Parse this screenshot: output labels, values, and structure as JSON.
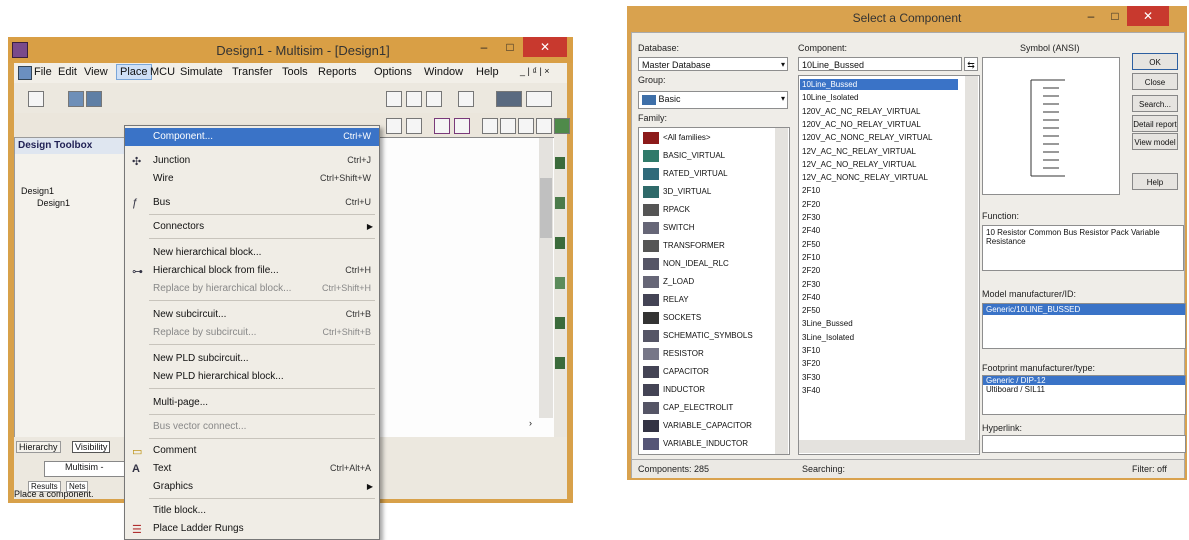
{
  "left_window": {
    "title": "Design1 - Multisim - [Design1]",
    "controls": {
      "minimize": "–",
      "maximize": "□",
      "close": "✕"
    },
    "menu": [
      "File",
      "Edit",
      "View",
      "Place",
      "MCU",
      "Simulate",
      "Transfer",
      "Tools",
      "Reports",
      "Options",
      "Window",
      "Help"
    ],
    "menu_right": "_ | ₫ | ×",
    "design_toolbox": {
      "header": "Design Toolbox",
      "tree": [
        "Design1",
        "Design1"
      ]
    },
    "bottom_tabs": [
      "Hierarchy",
      "Visibility"
    ],
    "bottom_panel_text": "Multisim - ",
    "results_tabs": [
      "Results",
      "Nets"
    ],
    "status_text": "Place a component.",
    "place_menu": [
      {
        "label": "Component...",
        "shortcut": "Ctrl+W",
        "highlight": true
      },
      {
        "label": "Junction",
        "shortcut": "Ctrl+J",
        "icon": "junction-icon"
      },
      {
        "label": "Wire",
        "shortcut": "Ctrl+Shift+W"
      },
      {
        "label": "Bus",
        "shortcut": "Ctrl+U",
        "icon": "bus-icon"
      },
      {
        "label": "Connectors",
        "shortcut": "",
        "submenu": true
      },
      {
        "label": "New hierarchical block...",
        "shortcut": ""
      },
      {
        "label": "Hierarchical block from file...",
        "shortcut": "Ctrl+H",
        "icon": "hier-icon"
      },
      {
        "label": "Replace by hierarchical block...",
        "shortcut": "Ctrl+Shift+H",
        "disabled": true
      },
      {
        "label": "New subcircuit...",
        "shortcut": "Ctrl+B"
      },
      {
        "label": "Replace by subcircuit...",
        "shortcut": "Ctrl+Shift+B",
        "disabled": true
      },
      {
        "label": "New PLD subcircuit...",
        "shortcut": ""
      },
      {
        "label": "New PLD hierarchical block...",
        "shortcut": ""
      },
      {
        "label": "Multi-page...",
        "shortcut": ""
      },
      {
        "label": "Bus vector connect...",
        "shortcut": "",
        "disabled": true
      },
      {
        "label": "Comment",
        "shortcut": "",
        "icon": "comment-icon"
      },
      {
        "label": "Text",
        "shortcut": "Ctrl+Alt+A",
        "icon": "text-icon"
      },
      {
        "label": "Graphics",
        "shortcut": "",
        "submenu": true
      },
      {
        "label": "Title block...",
        "shortcut": ""
      },
      {
        "label": "Place Ladder Rungs",
        "shortcut": "",
        "icon": "ladder-icon"
      }
    ]
  },
  "right_window": {
    "title": "Select a Component",
    "controls": {
      "minimize": "–",
      "maximize": "□",
      "close": "✕"
    },
    "database_label": "Database:",
    "database_value": "Master Database",
    "group_label": "Group:",
    "group_value": "Basic",
    "family_label": "Family:",
    "families": [
      "<All families>",
      "BASIC_VIRTUAL",
      "RATED_VIRTUAL",
      "3D_VIRTUAL",
      "RPACK",
      "SWITCH",
      "TRANSFORMER",
      "NON_IDEAL_RLC",
      "Z_LOAD",
      "RELAY",
      "SOCKETS",
      "SCHEMATIC_SYMBOLS",
      "RESISTOR",
      "CAPACITOR",
      "INDUCTOR",
      "CAP_ELECTROLIT",
      "VARIABLE_CAPACITOR",
      "VARIABLE_INDUCTOR"
    ],
    "component_label": "Component:",
    "component_value": "10Line_Bussed",
    "components": [
      "10Line_Bussed",
      "10Line_Isolated",
      "120V_AC_NC_RELAY_VIRTUAL",
      "120V_AC_NO_RELAY_VIRTUAL",
      "120V_AC_NONC_RELAY_VIRTUAL",
      "12V_AC_NC_RELAY_VIRTUAL",
      "12V_AC_NO_RELAY_VIRTUAL",
      "12V_AC_NONC_RELAY_VIRTUAL",
      "2F10",
      "2F20",
      "2F30",
      "2F40",
      "2F50",
      "2F10",
      "2F20",
      "2F30",
      "2F40",
      "2F50",
      "3Line_Bussed",
      "3Line_Isolated",
      "3F10",
      "3F20",
      "3F30",
      "3F40"
    ],
    "symbol_label": "Symbol (ANSI)",
    "buttons": [
      "OK",
      "Close",
      "Search...",
      "Detail report",
      "View model",
      "Help"
    ],
    "function_label": "Function:",
    "function_text": "10 Resistor Common Bus Resistor Pack Variable Resistance",
    "model_manuf_label": "Model manufacturer/ID:",
    "model_manuf_value": "Generic/10LINE_BUSSED",
    "footprint_label": "Footprint manufacturer/type:",
    "footprint_values": [
      "Generic / DIP-12",
      "Ultiboard / SIL11"
    ],
    "hyperlink_label": "Hyperlink:",
    "status": {
      "components": "Components: 285",
      "searching": "Searching:",
      "filter": "Filter: off"
    }
  }
}
